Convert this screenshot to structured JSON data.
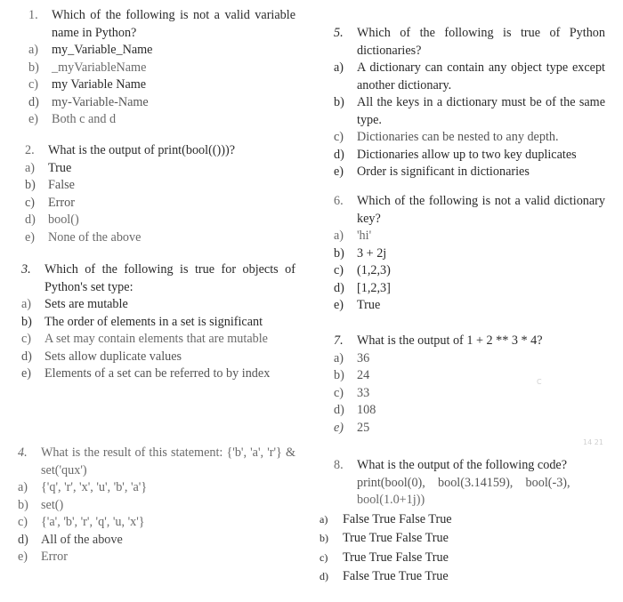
{
  "questions": [
    {
      "number": "1.",
      "text": "Which of the following is not a valid variable name in Python?",
      "options": [
        {
          "label": "a)",
          "text": "my_Variable_Name"
        },
        {
          "label": "b)",
          "text": "_myVariableName"
        },
        {
          "label": "c)",
          "text": "my Variable Name"
        },
        {
          "label": "d)",
          "text": "my-Variable-Name"
        },
        {
          "label": "e)",
          "text": "Both c and d"
        }
      ]
    },
    {
      "number": "2.",
      "text": "What is the output of print(bool(()))?",
      "options": [
        {
          "label": "a)",
          "text": "True"
        },
        {
          "label": "b)",
          "text": "False"
        },
        {
          "label": "c)",
          "text": "Error"
        },
        {
          "label": "d)",
          "text": "bool()"
        },
        {
          "label": "e)",
          "text": "None of the above"
        }
      ]
    },
    {
      "number": "3.",
      "text": "Which of the following is true for objects of Python's set type:",
      "options": [
        {
          "label": "a)",
          "text": "Sets are mutable"
        },
        {
          "label": "b)",
          "text": "The order of elements in a set is significant"
        },
        {
          "label": "c)",
          "text": "A set may contain elements that are mutable"
        },
        {
          "label": "d)",
          "text": "Sets allow duplicate values"
        },
        {
          "label": "e)",
          "text": "Elements of a set can be referred to by index"
        }
      ]
    },
    {
      "number": "4.",
      "text": "What is the result of this statement: {'b', 'a', 'r'} & set('qux')",
      "options": [
        {
          "label": "a)",
          "text": "{'q', 'r', 'x', 'u', 'b', 'a'}"
        },
        {
          "label": "b)",
          "text": "set()"
        },
        {
          "label": "c)",
          "text": "{'a', 'b', 'r', 'q', 'u, 'x'}"
        },
        {
          "label": "d)",
          "text": "All of the above"
        },
        {
          "label": "e)",
          "text": "Error"
        }
      ]
    },
    {
      "number": "5.",
      "text": "Which of the following is true of Python dictionaries?",
      "options": [
        {
          "label": "a)",
          "text": "A dictionary can contain any object type except another dictionary."
        },
        {
          "label": "b)",
          "text": "All the keys in a dictionary must be of the same type."
        },
        {
          "label": "c)",
          "text": "Dictionaries can be nested to any depth."
        },
        {
          "label": "d)",
          "text": "Dictionaries allow up to two key duplicates"
        },
        {
          "label": "e)",
          "text": "Order is significant in dictionaries"
        }
      ]
    },
    {
      "number": "6.",
      "text": "Which of the following is not a valid dictionary key?",
      "options": [
        {
          "label": "a)",
          "text": "'hi'"
        },
        {
          "label": "b)",
          "text": "3 + 2j"
        },
        {
          "label": "c)",
          "text": "(1,2,3)"
        },
        {
          "label": "d)",
          "text": "[1,2,3]"
        },
        {
          "label": "e)",
          "text": "True"
        }
      ]
    },
    {
      "number": "7.",
      "text": "What is the output of 1 + 2 ** 3 * 4?",
      "options": [
        {
          "label": "a)",
          "text": "36"
        },
        {
          "label": "b)",
          "text": "24"
        },
        {
          "label": "c)",
          "text": "33"
        },
        {
          "label": "d)",
          "text": "108"
        },
        {
          "label": "e)",
          "text": "25"
        }
      ]
    },
    {
      "number": "8.",
      "text": "What is the output of the following code?",
      "code_line1": "print(bool(0),    bool(3.14159),    bool(-3),",
      "code_line2": "bool(1.0+1j))",
      "options": [
        {
          "label": "a)",
          "text": "False True False True"
        },
        {
          "label": "b)",
          "text": "True True False True"
        },
        {
          "label": "c)",
          "text": "True True False True"
        },
        {
          "label": "d)",
          "text": "False True True True"
        }
      ]
    }
  ],
  "pencil_marks": [
    "C",
    "14 21"
  ]
}
